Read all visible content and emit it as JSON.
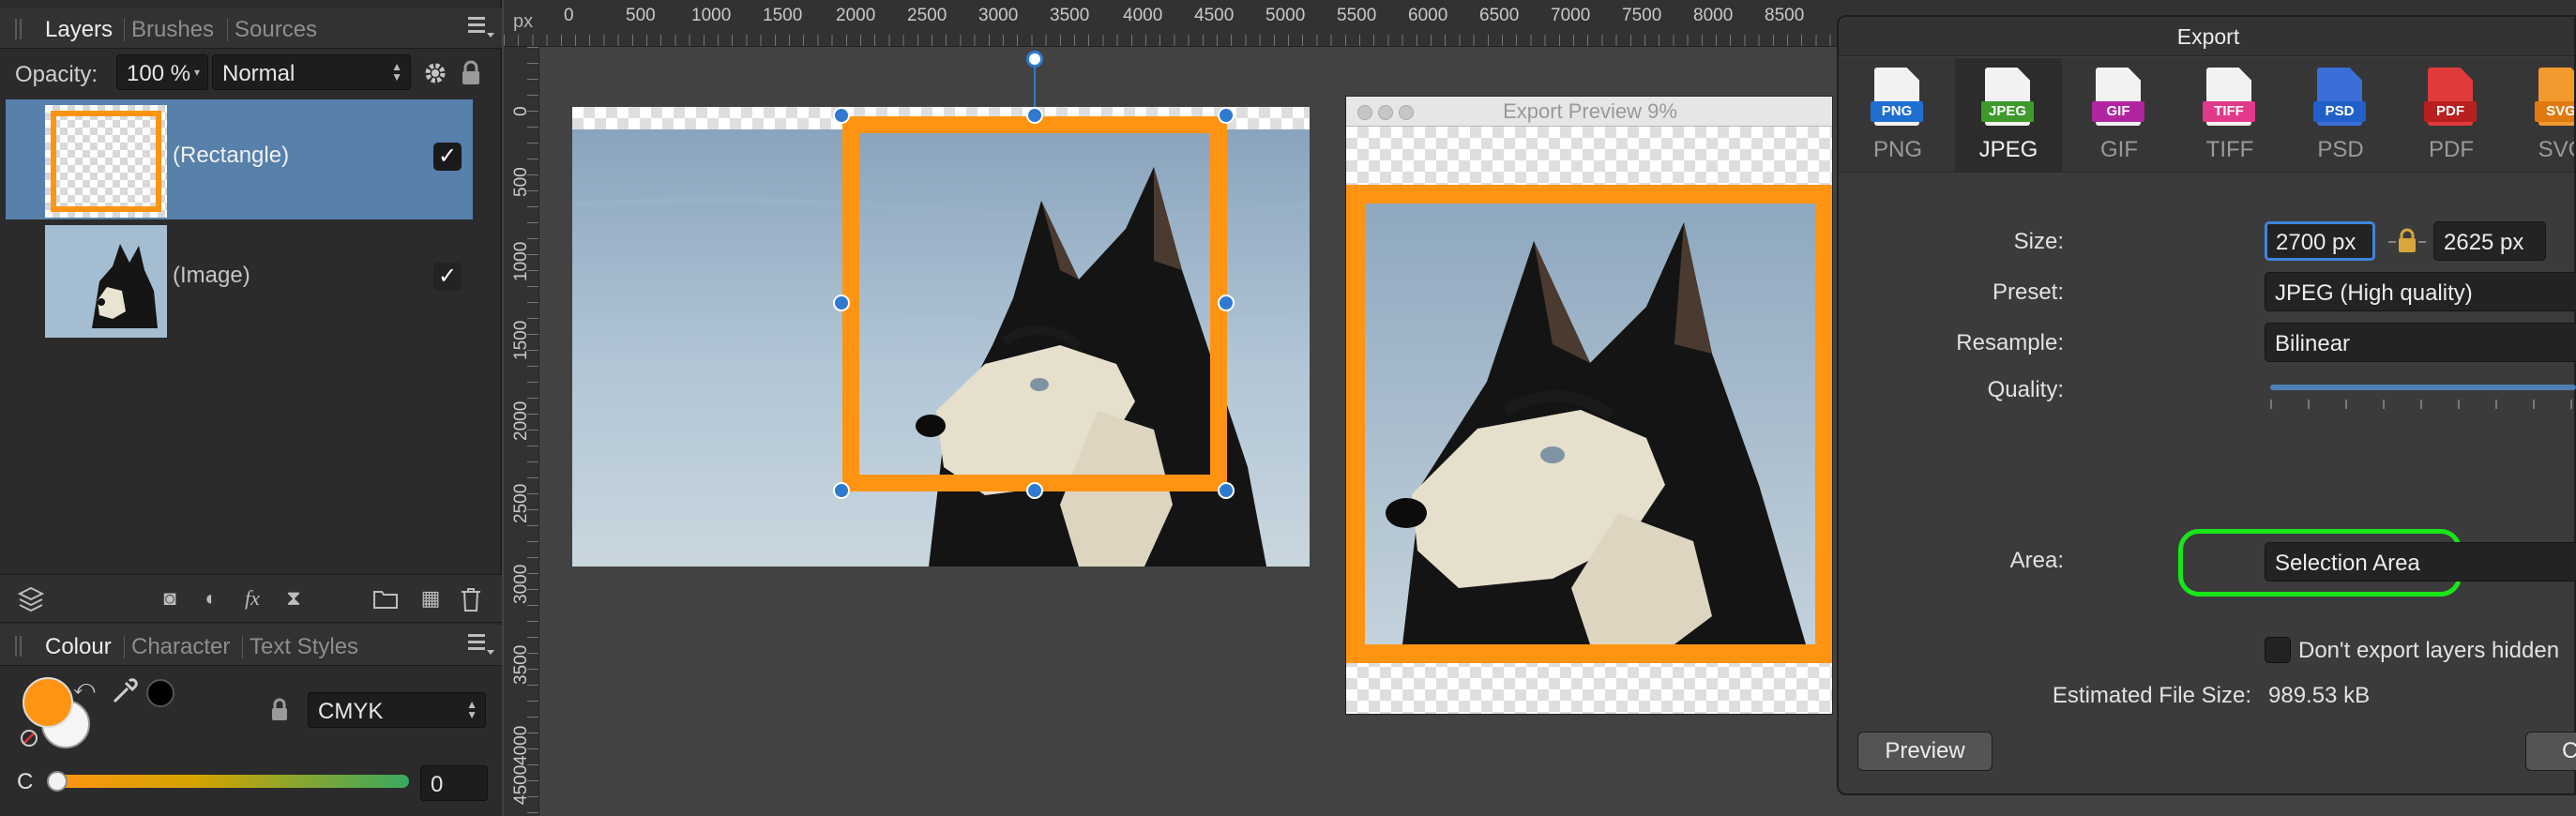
{
  "layers_panel": {
    "tabs": [
      {
        "label": "Layers",
        "active": true
      },
      {
        "label": "Brushes",
        "active": false
      },
      {
        "label": "Sources",
        "active": false
      }
    ],
    "opacity_label": "Opacity:",
    "opacity_value": "100 %",
    "blend_mode": "Normal",
    "layers": [
      {
        "name": "(Rectangle)",
        "selected": true,
        "visible": true
      },
      {
        "name": "(Image)",
        "selected": false,
        "visible": true
      }
    ],
    "check_glyph": "✓"
  },
  "colour_panel": {
    "tabs": [
      {
        "label": "Colour",
        "active": true
      },
      {
        "label": "Character",
        "active": false
      },
      {
        "label": "Text Styles",
        "active": false
      }
    ],
    "model": "CMYK",
    "channel_label": "C",
    "channel_value": "0",
    "fill_color": "#ff9412"
  },
  "ruler": {
    "unit": "px",
    "top_labels": [
      "0",
      "500",
      "1000",
      "1500",
      "2000",
      "2500",
      "3000",
      "3500",
      "4000",
      "4500",
      "5000",
      "5500",
      "6000",
      "6500",
      "7000",
      "7500",
      "8000",
      "8500"
    ],
    "left_labels": [
      "0",
      "500",
      "1000",
      "1500",
      "2000",
      "2500",
      "3000",
      "3500",
      "4000",
      "4500"
    ]
  },
  "preview_window": {
    "title": "Export Preview 9%"
  },
  "export_dialog": {
    "title": "Export",
    "formats": [
      {
        "label": "PNG",
        "badge": "PNG",
        "color": "#1f6fd1",
        "active": false
      },
      {
        "label": "JPEG",
        "badge": "JPEG",
        "color": "#3d9a2b",
        "active": true
      },
      {
        "label": "GIF",
        "badge": "GIF",
        "color": "#b0259f",
        "active": false
      },
      {
        "label": "TIFF",
        "badge": "TIFF",
        "color": "#e23a8a",
        "active": false
      },
      {
        "label": "PSD",
        "badge": "PSD",
        "color": "#2160c8",
        "active": false
      },
      {
        "label": "PDF",
        "badge": "PDF",
        "color": "#d42a2a",
        "active": false
      },
      {
        "label": "SVG",
        "badge": "SVG",
        "color": "#f08a1c",
        "active": false
      }
    ],
    "size_label": "Size:",
    "width": "2700 px",
    "height": "2625 px",
    "preset_label": "Preset:",
    "preset": "JPEG (High quality)",
    "resample_label": "Resample:",
    "resample": "Bilinear",
    "quality_label": "Quality:",
    "area_label": "Area:",
    "area": "Selection Area",
    "hidden_layers_label": "Don't export layers hidden",
    "estimated_label": "Estimated File Size:",
    "estimated_value": "989.53 kB",
    "preview_button": "Preview",
    "export_button_partial": "C"
  },
  "accent_colors": {
    "selection": "#5780ab",
    "handle": "#2f7ad0",
    "rectangle": "#ff9412",
    "highlight": "#19e619"
  }
}
